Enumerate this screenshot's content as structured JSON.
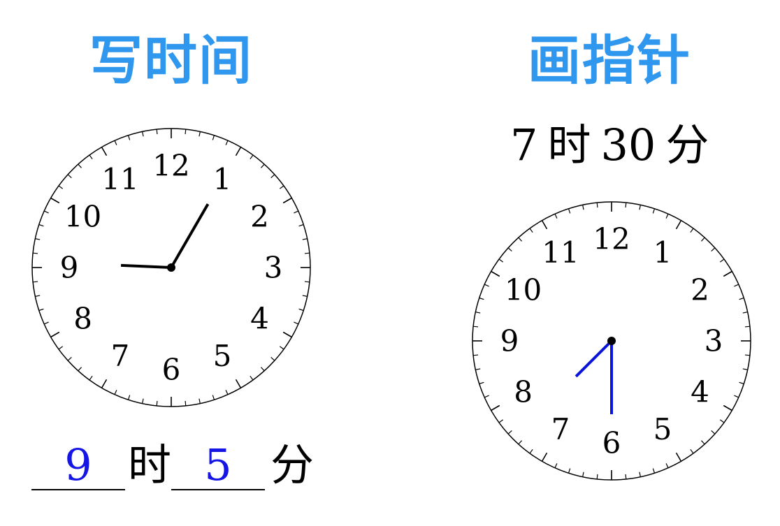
{
  "left_panel": {
    "title": "写时间",
    "clock": {
      "numerals": [
        "12",
        "1",
        "2",
        "3",
        "4",
        "5",
        "6",
        "7",
        "8",
        "9",
        "10",
        "11"
      ],
      "hour": 9,
      "minute": 5,
      "hand_color": "#000000"
    },
    "answer": {
      "hour_value": "9",
      "hour_unit": "时",
      "minute_value": "5",
      "minute_unit": "分",
      "answer_color": "#1515e6"
    }
  },
  "right_panel": {
    "title": "画指针",
    "prompt": {
      "hour": "7",
      "hour_unit": "时",
      "minute": "30",
      "minute_unit": "分"
    },
    "clock": {
      "numerals": [
        "12",
        "1",
        "2",
        "3",
        "4",
        "5",
        "6",
        "7",
        "8",
        "9",
        "10",
        "11"
      ],
      "hour": 7,
      "minute": 30,
      "hand_color": "#0a14d8"
    }
  },
  "colors": {
    "title": "#2f97ee",
    "text": "#000000"
  }
}
